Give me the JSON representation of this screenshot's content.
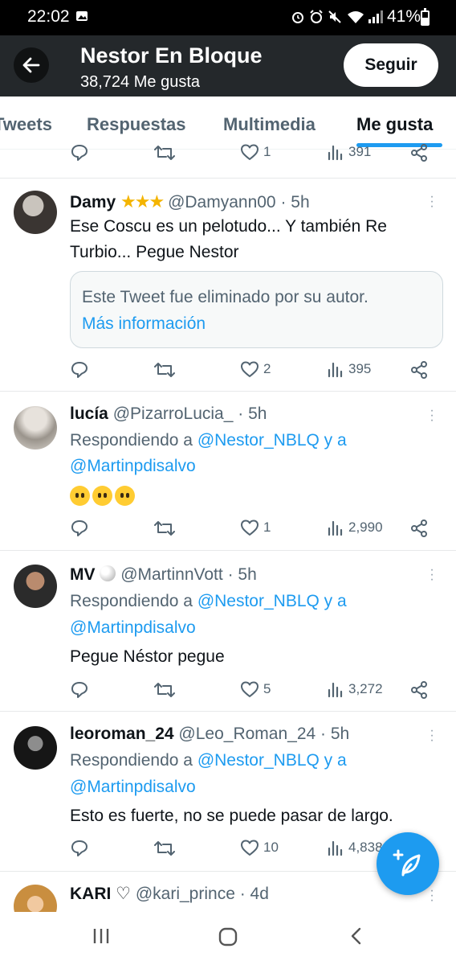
{
  "status_bar": {
    "time": "22:02",
    "battery": "41%",
    "icons": [
      "image-icon",
      "alarm-icon",
      "mute-icon",
      "wifi-icon",
      "signal-icon",
      "battery-icon"
    ]
  },
  "header": {
    "name": "Nestor En Bloque",
    "subtitle": "38,724 Me gusta",
    "follow_label": "Seguir"
  },
  "tabs": [
    {
      "label": "Tweets",
      "active": false
    },
    {
      "label": "Respuestas",
      "active": false
    },
    {
      "label": "Multimedia",
      "active": false
    },
    {
      "label": "Me gusta",
      "active": true
    }
  ],
  "colors": {
    "accent": "#1d9bf0",
    "text": "#0f1419",
    "muted": "#536471",
    "header_bg": "#24282b"
  },
  "partial_actions": {
    "likes": "1",
    "views": "391"
  },
  "tweets": [
    {
      "name": "Damy",
      "handle": "@Damyann00",
      "time": "· 5h",
      "lines": [
        "Ese Coscu es un pelotudo... Y también Re",
        "Turbio... Pegue Nestor"
      ],
      "quote": {
        "text": "Este Tweet fue eliminado por su autor.",
        "link": "Más información"
      },
      "likes": "2",
      "views": "395"
    },
    {
      "name": "lucía",
      "handle": "@PizarroLucia_",
      "time": "· 5h",
      "reply_prefix": "Respondiendo a",
      "reply_to": "@Nestor_NBLQ y a",
      "reply_to2": "@Martinpdisalvo",
      "likes": "1",
      "views": "2,990"
    },
    {
      "name": "MV",
      "handle": "@MartinnVott",
      "time": "· 5h",
      "reply_prefix": "Respondiendo a",
      "reply_to": "@Nestor_NBLQ y a",
      "reply_to2": "@Martinpdisalvo",
      "body": "Pegue Néstor pegue",
      "likes": "5",
      "views": "3,272"
    },
    {
      "name": "leoroman_24",
      "handle": "@Leo_Roman_24",
      "time": "· 5h",
      "reply_prefix": "Respondiendo a",
      "reply_to": "@Nestor_NBLQ y a",
      "reply_to2": "@Martinpdisalvo",
      "body": "Esto es fuerte, no se puede pasar de largo.",
      "likes": "10",
      "views": "4,838"
    },
    {
      "name": "KARI ♡",
      "handle": "@kari_prince",
      "time": "· 4d"
    }
  ]
}
